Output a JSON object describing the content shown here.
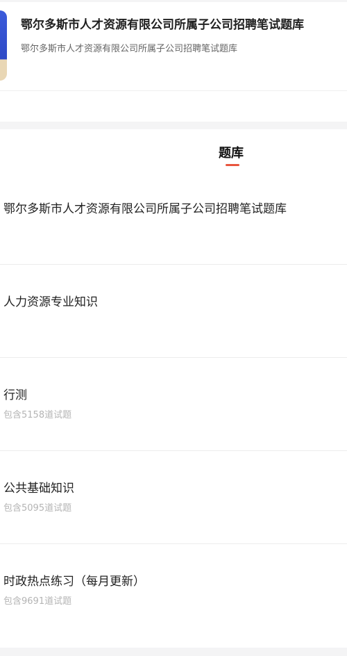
{
  "header": {
    "title": "鄂尔多斯市人才资源有限公司所属子公司招聘笔试题库",
    "subtitle": "鄂尔多斯市人才资源有限公司所属子公司招聘笔试题库"
  },
  "tab": {
    "label": "题库",
    "accent": "#e8553e"
  },
  "items": [
    {
      "title": "鄂尔多斯市人才资源有限公司所属子公司招聘笔试题库",
      "count": ""
    },
    {
      "title": "人力资源专业知识",
      "count": ""
    },
    {
      "title": "行测",
      "count": "包含5158道试题"
    },
    {
      "title": "公共基础知识",
      "count": "包含5095道试题"
    },
    {
      "title": "时政热点练习（每月更新）",
      "count": "包含9691道试题"
    }
  ]
}
